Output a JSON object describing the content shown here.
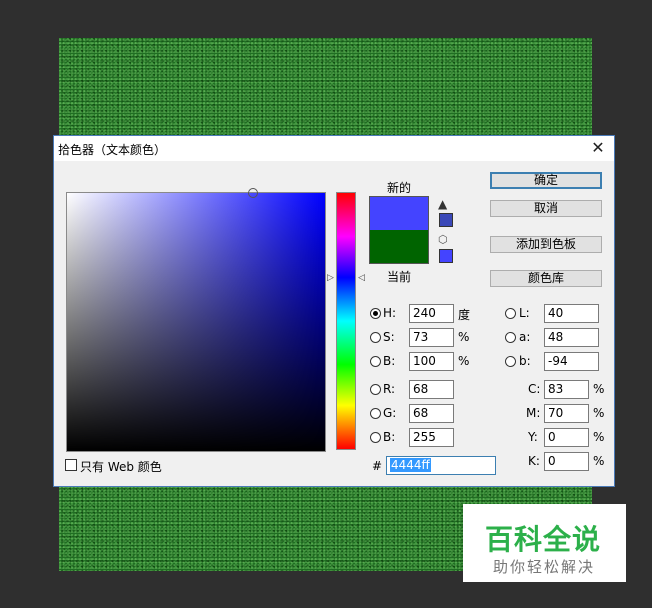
{
  "dialog": {
    "title": "拾色器（文本颜色）",
    "close_glyph": "✕",
    "new_label": "新的",
    "current_label": "当前",
    "new_color": "#4444ff",
    "current_color": "#006400",
    "gamut_warning_color": "#3a48b8",
    "web_safe_color": "#4444ff"
  },
  "buttons": {
    "ok": "确定",
    "cancel": "取消",
    "add_swatch": "添加到色板",
    "color_library": "颜色库"
  },
  "hsb": {
    "h_label": "H:",
    "h_value": "240",
    "h_unit": "度",
    "s_label": "S:",
    "s_value": "73",
    "s_unit": "%",
    "b_label": "B:",
    "b_value": "100",
    "b_unit": "%"
  },
  "rgb": {
    "r_label": "R:",
    "r_value": "68",
    "g_label": "G:",
    "g_value": "68",
    "b_label": "B:",
    "b_value": "255"
  },
  "lab": {
    "l_label": "L:",
    "l_value": "40",
    "a_label": "a:",
    "a_value": "48",
    "b_label": "b:",
    "b_value": "-94"
  },
  "cmyk": {
    "c_label": "C:",
    "c_value": "83",
    "c_unit": "%",
    "m_label": "M:",
    "m_value": "70",
    "m_unit": "%",
    "y_label": "Y:",
    "y_value": "0",
    "y_unit": "%",
    "k_label": "K:",
    "k_value": "0",
    "k_unit": "%"
  },
  "hex": {
    "label": "#",
    "value": "4444ff"
  },
  "web_only_label": "只有 Web 颜色",
  "watermark": {
    "title": "百科全说",
    "subtitle": "助你轻松解决"
  }
}
